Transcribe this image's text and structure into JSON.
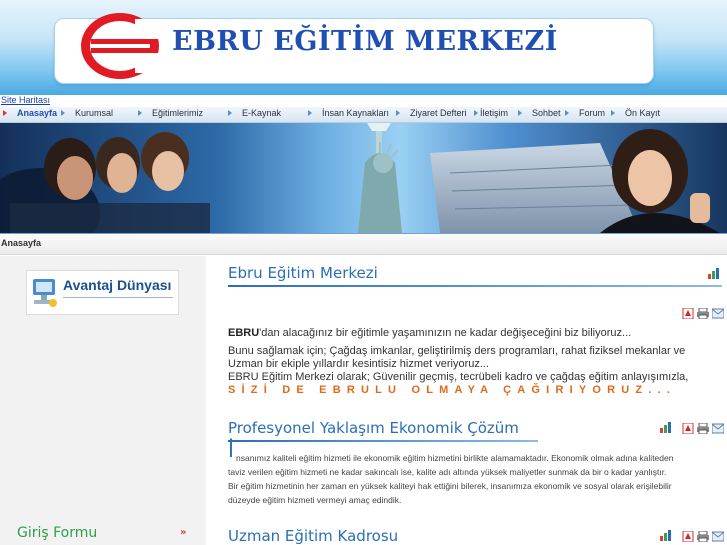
{
  "header": {
    "title": "EBRU EĞİTİM MERKEZİ"
  },
  "sitemap": {
    "label": "Site Haritası"
  },
  "nav": {
    "items": [
      {
        "label": "Anasayfa",
        "active": true
      },
      {
        "label": "Kurumsal"
      },
      {
        "label": "Eğitimlerimiz"
      },
      {
        "label": "E-Kaynak"
      },
      {
        "label": "İnsan Kaynakları"
      },
      {
        "label": "Ziyaret Defteri"
      },
      {
        "label": "İletişim"
      },
      {
        "label": "Sohbet"
      },
      {
        "label": "Forum"
      },
      {
        "label": "Ön Kayıt"
      }
    ]
  },
  "breadcrumb": {
    "label": "Anasayfa"
  },
  "sidebar": {
    "avantaj": "Avantaj Dünyası",
    "login_title": "Giriş Formu",
    "login_toggle": "»"
  },
  "sections": [
    {
      "title": "Ebru Eğitim Merkezi",
      "intro_bold": "EBRU",
      "intro_rest": "'dan alacağınız bir eğitimle yaşamınızın ne kadar değişeceğini biz biliyoruz...",
      "lines": [
        "Bunu sağlamak için; Çağdaş imkanlar, geliştirilmiş ders programları, rahat fiziksel mekanlar ve",
        "Uzman bir ekiple yıllardır kesintisiz hizmet veriyoruz...",
        "EBRU Eğitim Merkezi olarak; Güvenilir geçmiş, tecrübeli kadro ve çağdaş eğitim anlayışımızla,"
      ],
      "slogan": "SİZİ DE EBRULU OLMAYA ÇAĞIRIYORUZ..."
    },
    {
      "title": "Profesyonel Yaklaşım Ekonomik Çözüm",
      "first_letter": "İ",
      "lines": [
        "nsanımız kaliteli eğitim hizmeti ile ekonomik eğitim hizmetini birlikte alamamaktadır. Ekonomik olmak adına kaliteden",
        "taviz verilen eğitim hizmeti ne kadar sakıncalı ise, kalite adı altında yüksek maliyetler sunmak da bir o kadar yanlıştır.",
        "Bir eğitim hizmetinin her zaman en yüksek kaliteyi hak ettiğini bilerek, insanımıza ekonomik ve sosyal olarak erişilebilir",
        "düzeyde eğitim hizmeti vermeyi amaç edindik."
      ]
    },
    {
      "title": "Uzman Eğitim Kadrosu"
    }
  ],
  "colors": {
    "accent": "#2a6fb6",
    "slogan": "#e06a1a",
    "login": "#2ca14a",
    "logo_red": "#e01b24"
  }
}
